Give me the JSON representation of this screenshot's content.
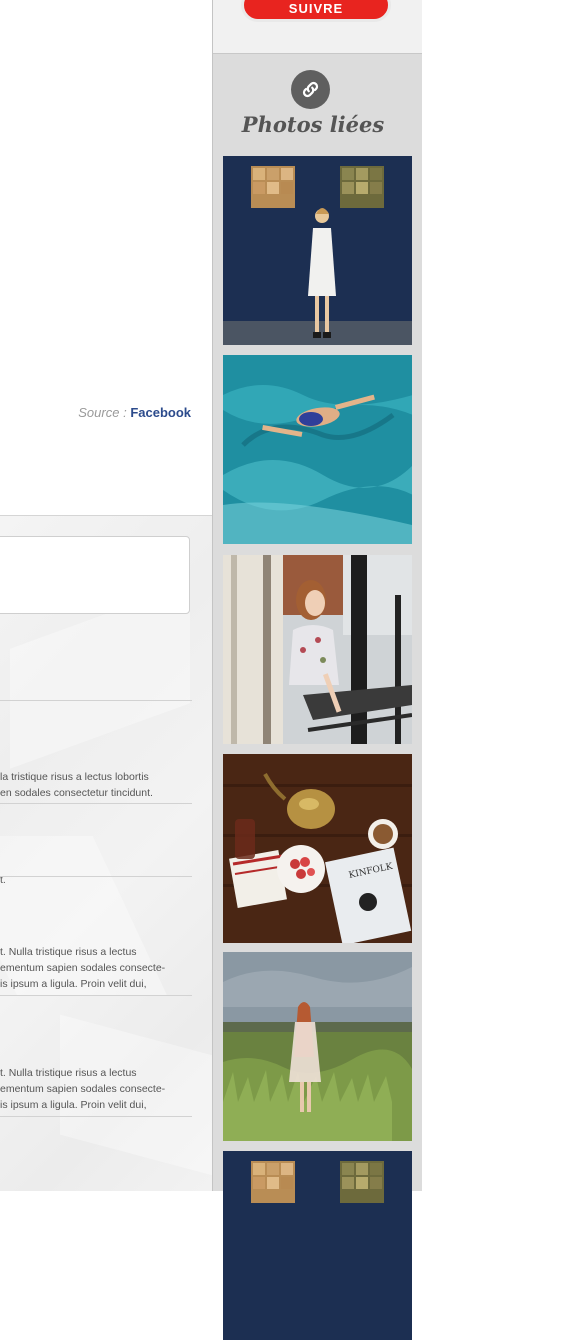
{
  "source": {
    "label": "Source :",
    "link": "Facebook"
  },
  "comments": {
    "items": [
      {
        "lines": [
          "la tristique risus a lectus lobortis",
          "en sodales consectetur tincidunt."
        ]
      },
      {
        "lines": [
          "t."
        ]
      },
      {
        "lines": [
          "t. Nulla tristique risus a lectus",
          "ementum sapien sodales consecte-",
          "is ipsum a ligula. Proin velit dui,"
        ]
      },
      {
        "lines": [
          "t. Nulla tristique risus a lectus",
          "ementum sapien sodales consecte-",
          "is ipsum a ligula. Proin velit dui,"
        ]
      }
    ]
  },
  "sidebar": {
    "follow_label": "SUIVRE",
    "related_title": "Photos liées",
    "photos": [
      "woman-white-dress-blue-wall",
      "swimmer-in-pool",
      "woman-on-balcony",
      "kinfolk-table-still-life",
      "woman-in-field",
      "woman-white-dress-blue-wall"
    ]
  },
  "colors": {
    "accent_red": "#e8241f",
    "link_blue": "#2c4b8c",
    "sidebar_bg": "#dcdcdc"
  }
}
